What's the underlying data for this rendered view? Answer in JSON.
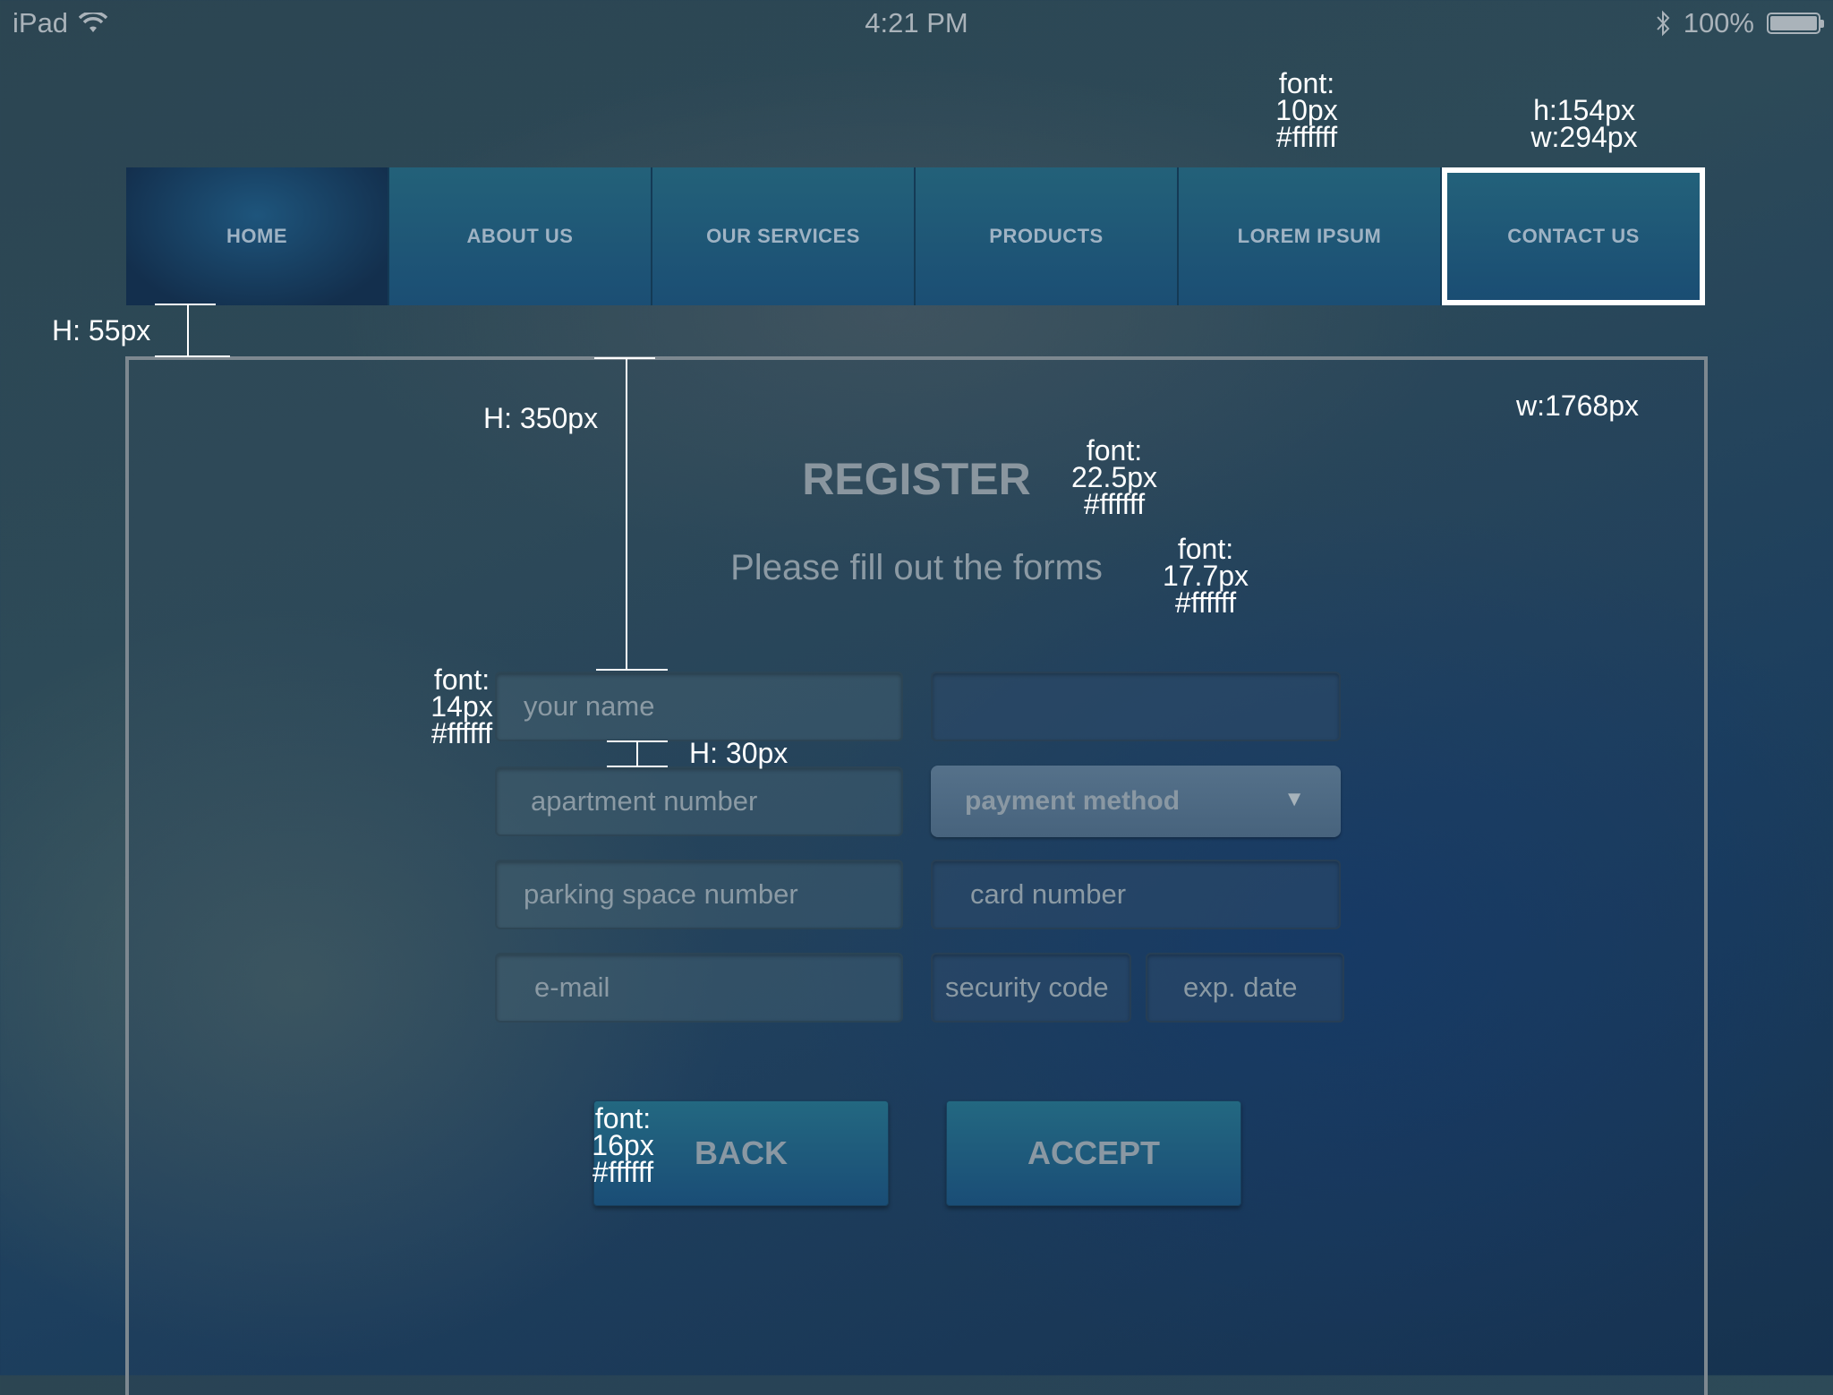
{
  "status_bar": {
    "device": "iPad",
    "time": "4:21 PM",
    "battery": "100%"
  },
  "nav": {
    "items": [
      {
        "label": "HOME"
      },
      {
        "label": "ABOUT US"
      },
      {
        "label": "OUR SERVICES"
      },
      {
        "label": "PRODUCTS"
      },
      {
        "label": "LOREM IPSUM"
      },
      {
        "label": "CONTACT US"
      }
    ],
    "active_index": 5
  },
  "form": {
    "title": "REGISTER",
    "subtitle": "Please fill out the forms",
    "placeholders": {
      "name": "your name",
      "apartment": "apartment number",
      "parking": "parking space number",
      "email": "e-mail",
      "card": "card number",
      "security": "security code",
      "exp": "exp. date"
    },
    "payment_select": "payment method",
    "back_label": "BACK",
    "accept_label": "ACCEPT"
  },
  "annotations": {
    "nav_font_1": "font:",
    "nav_font_2": "10px",
    "nav_font_3": "#ffffff",
    "nav_size_1": "h:154px",
    "nav_size_2": "w:294px",
    "gap_height": "H: 55px",
    "title_offset": "H: 350px",
    "panel_width": "w:1768px",
    "title_font_1": "font:",
    "title_font_2": "22.5px",
    "title_font_3": "#ffffff",
    "subtitle_font_1": "font:",
    "subtitle_font_2": "17.7px",
    "subtitle_font_3": "#ffffff",
    "field_font_1": "font:",
    "field_font_2": "14px",
    "field_font_3": "#ffffff",
    "field_gap": "H: 30px",
    "button_font_1": "font:",
    "button_font_2": "16px",
    "button_font_3": "#ffffff"
  },
  "colors": {
    "accent": "#1b4e74",
    "annotation_text": "#ffffff"
  }
}
